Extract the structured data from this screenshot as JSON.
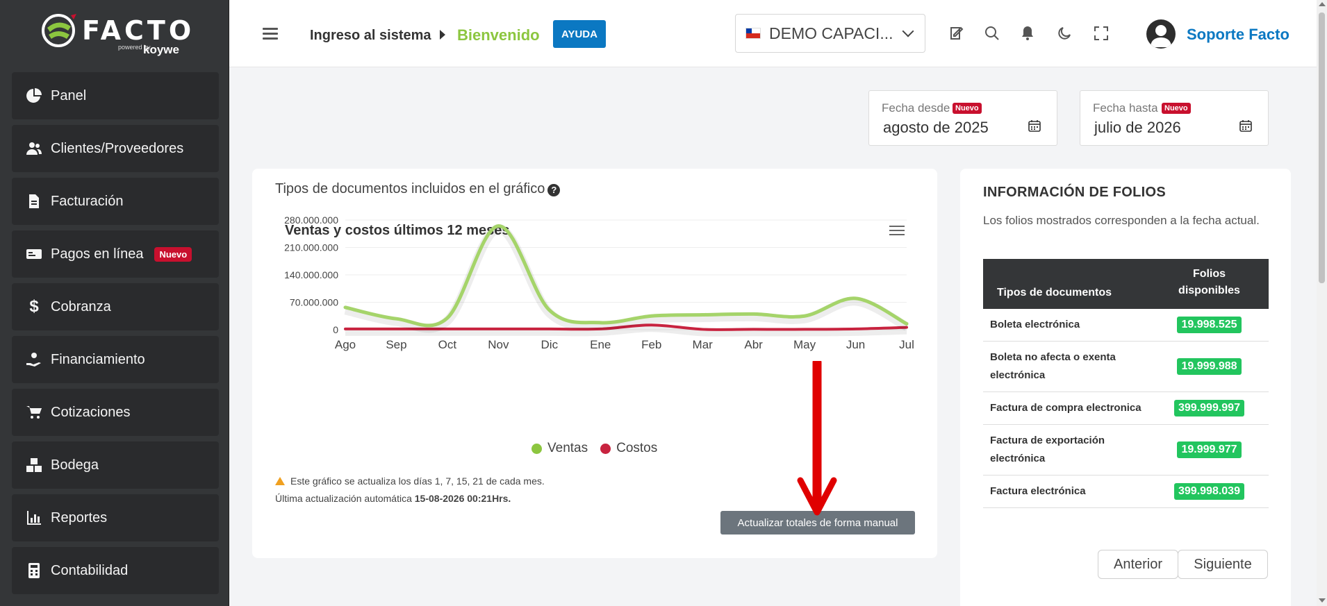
{
  "brand": {
    "name": "FACTO",
    "powered": "powered by",
    "partner": "koywe"
  },
  "sidebar": {
    "items": [
      {
        "label": "Panel",
        "icon": "pie-chart-icon"
      },
      {
        "label": "Clientes/Proveedores",
        "icon": "users-icon"
      },
      {
        "label": "Facturación",
        "icon": "file-icon"
      },
      {
        "label": "Pagos en línea",
        "icon": "money-card-icon",
        "badge": "Nuevo"
      },
      {
        "label": "Cobranza",
        "icon": "dollar-icon"
      },
      {
        "label": "Financiamiento",
        "icon": "hand-coin-icon"
      },
      {
        "label": "Cotizaciones",
        "icon": "cart-icon"
      },
      {
        "label": "Bodega",
        "icon": "boxes-icon"
      },
      {
        "label": "Reportes",
        "icon": "bar-chart-icon"
      },
      {
        "label": "Contabilidad",
        "icon": "calculator-icon"
      }
    ]
  },
  "header": {
    "breadcrumb": "Ingreso al sistema",
    "page": "Bienvenido",
    "help": "AYUDA",
    "company": "DEMO CAPACI...",
    "user": "Soporte Facto"
  },
  "filters": {
    "from_label": "Fecha desde",
    "from_badge": "Nuevo",
    "from_value": "agosto de 2025",
    "to_label": "Fecha hasta",
    "to_badge": "Nuevo",
    "to_value": "julio de 2026"
  },
  "chart_card": {
    "doc_types_label": "Tipos de documentos incluidos en el gráfico",
    "note_line1": "Este gráfico se actualiza los días 1, 7, 15, 21 de cada mes.",
    "note_line2_prefix": "Última actualización automática",
    "note_line2_value": "15-08-2026 00:21Hrs.",
    "update_button": "Actualizar totales de forma manual"
  },
  "chart_data": {
    "type": "line",
    "title": "Ventas y costos últimos 12 meses",
    "categories": [
      "Ago",
      "Sep",
      "Oct",
      "Nov",
      "Dic",
      "Ene",
      "Feb",
      "Mar",
      "Abr",
      "May",
      "Jun",
      "Jul"
    ],
    "ylim": [
      0,
      280000000
    ],
    "yticks": [
      "0",
      "70.000.000",
      "140.000.000",
      "210.000.000",
      "280.000.000"
    ],
    "series": [
      {
        "name": "Ventas",
        "color": "#a5d46a",
        "values": [
          57000000,
          28000000,
          30000000,
          265000000,
          50000000,
          18000000,
          35000000,
          38000000,
          40000000,
          35000000,
          80000000,
          15000000
        ]
      },
      {
        "name": "Costos",
        "color": "#c8233f",
        "values": [
          2000000,
          2000000,
          2000000,
          2000000,
          2000000,
          2000000,
          12000000,
          1000000,
          1000000,
          1000000,
          2000000,
          6000000
        ]
      }
    ],
    "legend": "bottom",
    "grid": true
  },
  "folios": {
    "title": "INFORMACIÓN DE FOLIOS",
    "description": "Los folios mostrados corresponden a la fecha actual.",
    "col_type": "Tipos de documentos",
    "col_available_1": "Folios",
    "col_available_2": "disponibles",
    "rows": [
      {
        "type": "Boleta electrónica",
        "available": "19.998.525"
      },
      {
        "type": "Boleta no afecta o exenta electrónica",
        "available": "19.999.988"
      },
      {
        "type": "Factura de compra electronica",
        "available": "399.999.997"
      },
      {
        "type": "Factura de exportación electrónica",
        "available": "19.999.977"
      },
      {
        "type": "Factura electrónica",
        "available": "399.998.039"
      }
    ],
    "prev": "Anterior",
    "next": "Siguiente"
  },
  "colors": {
    "accent_green": "#8cc63f",
    "accent_blue": "#0b78c2",
    "badge_red": "#c8102e",
    "folio_green": "#22c55e",
    "annotation": "#e00000"
  }
}
